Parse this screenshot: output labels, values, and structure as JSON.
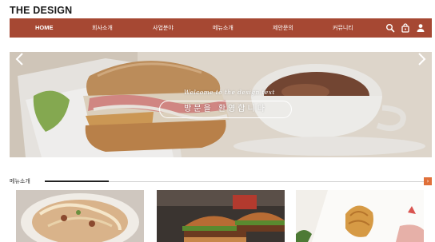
{
  "header": {
    "logo": "THE DESIGN"
  },
  "nav": {
    "items": [
      "HOME",
      "회사소개",
      "사업분야",
      "메뉴소개",
      "제안문의",
      "커뮤니티"
    ],
    "icons": [
      "search-icon",
      "bag-icon",
      "user-icon"
    ],
    "color": "#a64833"
  },
  "hero": {
    "script_text": "Welcome to the design text",
    "title": "방문을 환영합니다"
  },
  "section": {
    "title": "메뉴소개",
    "accent": "#e0703a"
  },
  "cards": [
    "pasta-dish",
    "burger",
    "croissant"
  ]
}
